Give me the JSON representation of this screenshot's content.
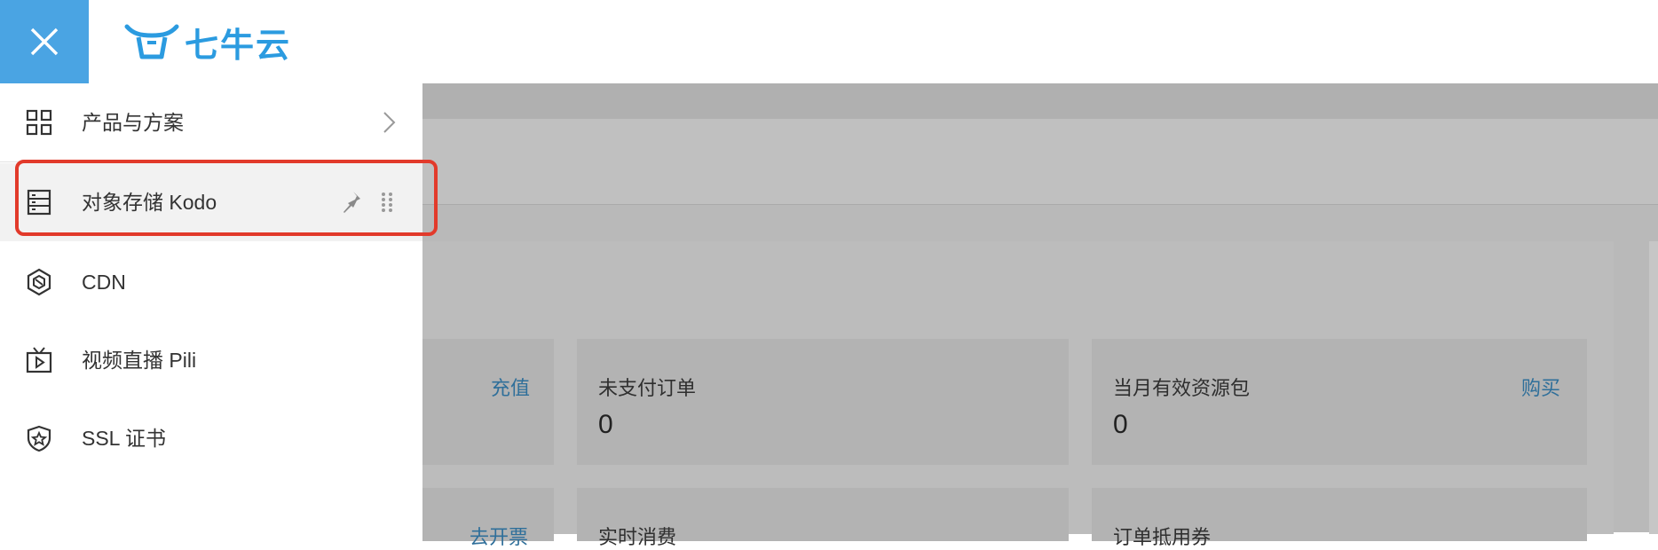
{
  "header": {
    "close_icon": "close-icon",
    "logo_text": "七牛云",
    "logo_icon": "qiniu-bull-logo",
    "accent_color": "#4aa4e3"
  },
  "drawer": {
    "items": [
      {
        "label": "产品与方案",
        "icon": "grid-icon",
        "trailing": "chevron-right-icon"
      },
      {
        "label": "对象存储 Kodo",
        "icon": "storage-icon",
        "trailing": "pin-icon",
        "selected": true
      },
      {
        "label": "CDN",
        "icon": "cdn-icon"
      },
      {
        "label": "视频直播 Pili",
        "icon": "tv-icon"
      },
      {
        "label": "SSL 证书",
        "icon": "shield-icon"
      }
    ]
  },
  "dashboard": {
    "recharge_link": "充值",
    "invoice_link": "去开票",
    "cards": [
      {
        "title": "未支付订单",
        "value": "0"
      },
      {
        "title": "当月有效资源包",
        "value": "0",
        "link": "购买"
      },
      {
        "title": "实时消费"
      },
      {
        "title": "订单抵用券"
      }
    ]
  },
  "colors": {
    "highlight": "#e23a2b",
    "link": "#2f6f9a",
    "overlay": "#b9b9b9"
  }
}
